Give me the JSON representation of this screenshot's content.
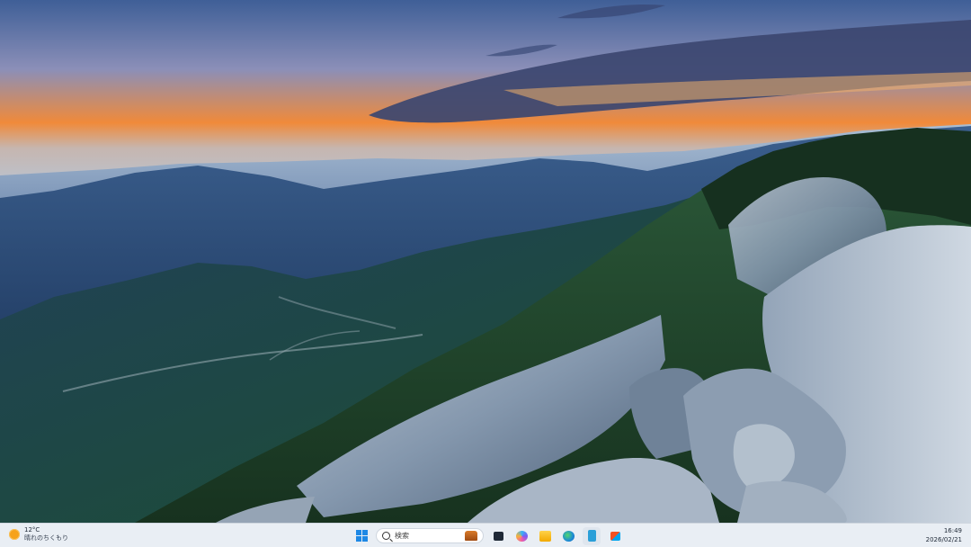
{
  "taskbar": {
    "weather": {
      "temp": "12°C",
      "condition": "晴れのちくもり"
    },
    "search": {
      "label": "検索"
    },
    "clock": {
      "time": "16:49",
      "date": "2026/02/21"
    },
    "apps": [
      "start-icon",
      "search-icon",
      "task-view-icon",
      "copilot-icon",
      "file-explorer-icon",
      "edge-icon",
      "notepad-icon",
      "store-icon"
    ]
  },
  "colors": {
    "taskbar_bg": "#e9eef4",
    "accent": "#1e88e5"
  }
}
